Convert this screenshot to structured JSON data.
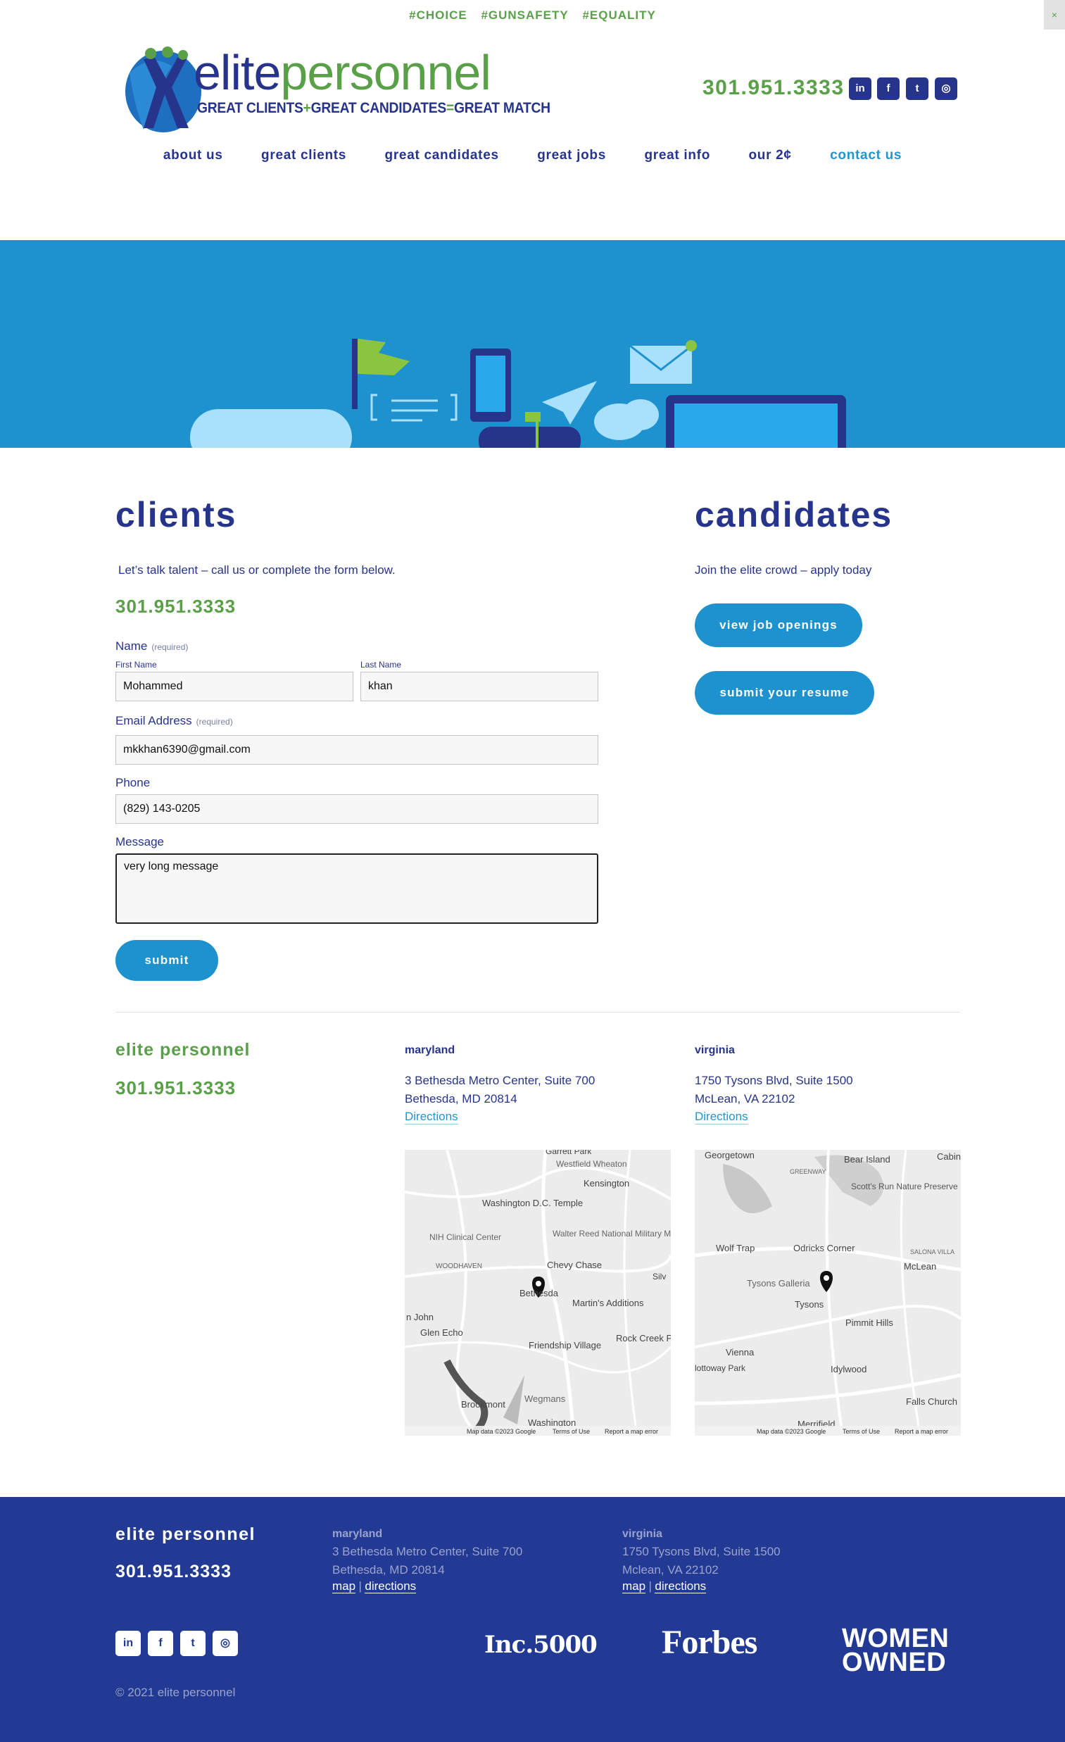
{
  "hashtags": [
    "#CHOICE",
    "#GUNSAFETY",
    "#EQUALITY"
  ],
  "close_label": "×",
  "logo": {
    "word1": "elite",
    "word2": "personnel",
    "tag_a": "GREAT CLIENTS",
    "tag_plus": "+",
    "tag_b": "GREAT CANDIDATES",
    "tag_eq": "=",
    "tag_c": "GREAT MATCH"
  },
  "header": {
    "phone": "301.951.3333",
    "social": [
      {
        "icon": "linkedin-icon",
        "glyph": "in"
      },
      {
        "icon": "facebook-icon",
        "glyph": "f"
      },
      {
        "icon": "twitter-icon",
        "glyph": "t"
      },
      {
        "icon": "instagram-icon",
        "glyph": "◎"
      }
    ]
  },
  "nav": [
    {
      "label": "about us",
      "active": false
    },
    {
      "label": "great clients",
      "active": false
    },
    {
      "label": "great candidates",
      "active": false
    },
    {
      "label": "great jobs",
      "active": false
    },
    {
      "label": "great info",
      "active": false
    },
    {
      "label": "our 2¢",
      "active": false
    },
    {
      "label": "contact us",
      "active": true
    }
  ],
  "clients": {
    "heading": "clients",
    "intro": "Let’s talk talent – call us or complete the form below.",
    "phone": "301.951.3333",
    "form": {
      "name_label": "Name",
      "required": "(required)",
      "first_label": "First Name",
      "first_value": "Mohammed",
      "last_label": "Last Name",
      "last_value": "khan",
      "email_label": "Email Address",
      "email_value": "mkkhan6390@gmail.com",
      "phone_label": "Phone",
      "phone_value": "(829) 143-0205",
      "message_label": "Message",
      "message_value": "very long message",
      "submit_label": "submit"
    }
  },
  "candidates": {
    "heading": "candidates",
    "intro": "Join the elite crowd – apply today",
    "view_jobs": "view job openings",
    "submit_resume": "submit your resume"
  },
  "locations": {
    "brand": "elite personnel",
    "phone": "301.951.3333",
    "maryland": {
      "title": "maryland",
      "line1": "3 Bethesda Metro Center, Suite 700",
      "line2": "Bethesda, MD 20814",
      "directions": "Directions",
      "map_labels": [
        "Garrett Park",
        "Westfield Wheaton",
        "Kensington",
        "Washington D.C. Temple",
        "NIH Clinical Center",
        "Walter Reed National Military Medical Center",
        "Chevy Chase",
        "Bethesda",
        "Martin's Additions",
        "Glen Echo",
        "Friendship Village",
        "Rock Creek Park",
        "Wegmans",
        "Brookmont",
        "Washington",
        "WOODHAVEN",
        "n John",
        "Silv"
      ],
      "map_footer": "Map data ©2023 Google",
      "terms": "Terms of Use",
      "report": "Report a map error"
    },
    "virginia": {
      "title": "virginia",
      "line1": "1750 Tysons Blvd, Suite 1500",
      "line2": "McLean, VA 22102",
      "directions": "Directions",
      "map_labels": [
        "Georgetown",
        "Bear Island",
        "Cabin",
        "Scott's Run Nature Preserve",
        "GREENWAY",
        "Wolf Trap",
        "Odricks Corner",
        "McLean",
        "SALONA VILLA",
        "Tysons Galleria",
        "Tysons",
        "Pimmit Hills",
        "Vienna",
        "lottoway Park",
        "Idylwood",
        "Falls Church",
        "Merrifield"
      ],
      "map_footer": "Map data ©2023 Google",
      "terms": "Terms of Use",
      "report": "Report a map error"
    }
  },
  "footer": {
    "brand": "elite personnel",
    "phone": "301.951.3333",
    "maryland": {
      "title": "maryland",
      "line1": "3 Bethesda Metro Center, Suite 700",
      "line2": "Bethesda, MD 20814",
      "map": "map",
      "sep": "|",
      "directions": "directions"
    },
    "virginia": {
      "title": "virginia",
      "line1": "1750 Tysons Blvd, Suite 1500",
      "line2": "Mclean, VA 22102",
      "map": "map",
      "sep": "|",
      "directions": "directions"
    },
    "social": [
      {
        "icon": "linkedin-icon",
        "glyph": "in"
      },
      {
        "icon": "facebook-icon",
        "glyph": "f"
      },
      {
        "icon": "twitter-icon",
        "glyph": "t"
      },
      {
        "icon": "instagram-icon",
        "glyph": "◎"
      }
    ],
    "copyright": "© 2021 elite personnel",
    "badges": {
      "inc": "Inc.5000",
      "forbes": "Forbes",
      "women_line1": "WOMEN",
      "women_line2": "OWNED"
    }
  },
  "colors": {
    "navy": "#27348b",
    "green": "#5aa049",
    "blue": "#1e92cf",
    "footer": "#233a94"
  }
}
